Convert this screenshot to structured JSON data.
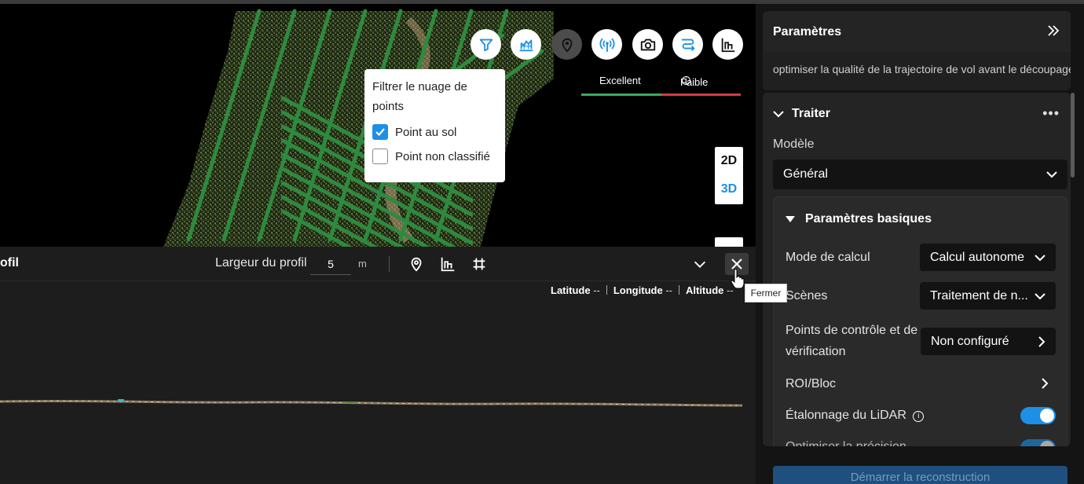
{
  "viewer": {
    "toolbar": [
      {
        "name": "filter-icon",
        "label": ""
      },
      {
        "name": "layers-chart-icon",
        "label": ""
      },
      {
        "name": "pin-icon",
        "label": ""
      },
      {
        "name": "signal-icon",
        "label": ""
      },
      {
        "name": "camera-icon",
        "label": ""
      },
      {
        "name": "route-icon",
        "label": ""
      },
      {
        "name": "profile-icon",
        "label": ""
      }
    ],
    "legend": {
      "excellent": "Excellent",
      "faible": "Faible"
    },
    "filter_popup": {
      "title": "Filtrer le nuage de points",
      "options": [
        {
          "label": "Point au sol",
          "checked": true
        },
        {
          "label": "Point non classifié",
          "checked": false
        }
      ]
    },
    "view_toggle": {
      "two_d": "2D",
      "three_d": "3D",
      "active": "3D"
    },
    "colors": {
      "accent": "#1d8fe6",
      "good": "#3cab5c",
      "bad": "#d43c44",
      "track": "#2e7d3a"
    }
  },
  "profile": {
    "title": "ofil",
    "width_label": "Largeur du profil",
    "width_value": "5",
    "unit": "m",
    "coords": {
      "latitude_label": "Latitude",
      "latitude_value": "--",
      "longitude_label": "Longitude",
      "longitude_value": "--",
      "altitude_label": "Altitude",
      "altitude_value": "--"
    },
    "close_tooltip": "Fermer"
  },
  "panel": {
    "params_title": "Paramètres",
    "params_desc": "optimiser la qualité de la trajectoire de vol avant le découpage",
    "traiter_title": "Traiter",
    "modele_label": "Modèle",
    "modele_value": "Général",
    "basic_title": "Paramètres basiques",
    "mode_label": "Mode de calcul",
    "mode_value": "Calcul autonome",
    "scenes_label": "Scènes",
    "scenes_value": "Traitement de n...",
    "control_label_1": "Points de contrôle et de",
    "control_label_2": "vérification",
    "control_value": "Non configuré",
    "roi_label": "ROI/Bloc",
    "lidar_label": "Étalonnage du LiDAR",
    "lidar_on": true,
    "partial_label": "Optimiser la précision",
    "start_button": "Démarrer la reconstruction"
  }
}
